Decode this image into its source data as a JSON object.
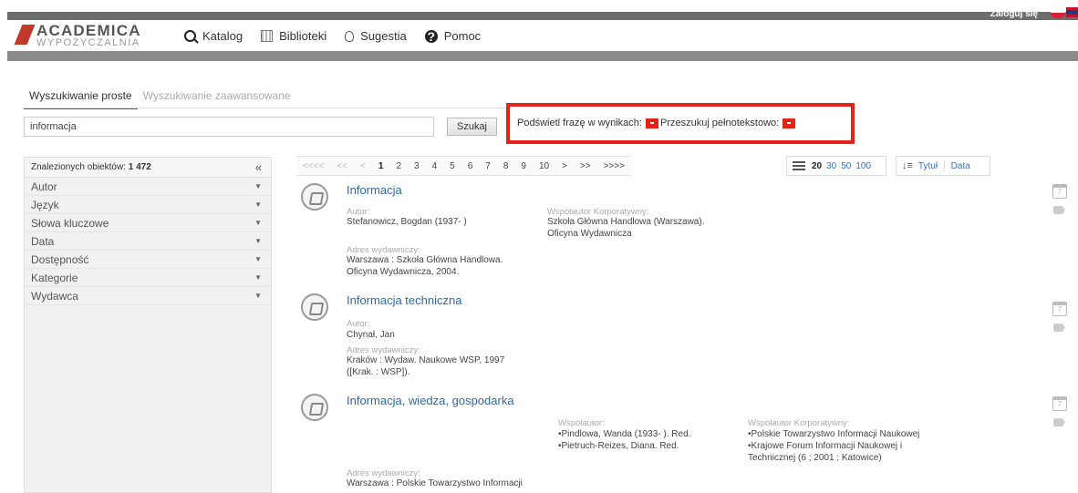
{
  "topbar": {
    "login": "Zaloguj się"
  },
  "logo": {
    "line1": "ACADEMICA",
    "line2": "WYPOŻYCZALNIA"
  },
  "nav": [
    {
      "label": "Katalog",
      "icon": "search-icon"
    },
    {
      "label": "Biblioteki",
      "icon": "library-icon"
    },
    {
      "label": "Sugestia",
      "icon": "lightbulb-icon"
    },
    {
      "label": "Pomoc",
      "icon": "help-icon"
    }
  ],
  "tabs": {
    "simple": "Wyszukiwanie proste",
    "advanced": "Wyszukiwanie zaawansowane"
  },
  "search": {
    "value": "informacja",
    "button": "Szukaj"
  },
  "options": {
    "highlight": "Podświetl frazę w wynikach:",
    "fulltext": "Przeszukuj pełnotekstowo:"
  },
  "sidebar": {
    "found_label": "Znalezionych obiektów:",
    "found_count": "1 472",
    "collapse": "«",
    "facets": [
      "Autor",
      "Język",
      "Słowa kluczowe",
      "Data",
      "Dostępność",
      "Kategorie",
      "Wydawca"
    ]
  },
  "pager": {
    "first": "<<<<",
    "prev_many": "<<",
    "prev": "<",
    "pages": [
      "1",
      "2",
      "3",
      "4",
      "5",
      "6",
      "7",
      "8",
      "9",
      "10"
    ],
    "next": ">",
    "next_many": ">>",
    "last": ">>>>"
  },
  "per_page": {
    "current": "20",
    "options": [
      "30",
      "50",
      "100"
    ]
  },
  "sort": {
    "title": "Tytuł",
    "date": "Data"
  },
  "results": [
    {
      "title": "Informacja",
      "author_label": "Autor:",
      "author": "Stefanowicz, Bogdan (1937- )",
      "corp_label": "Współautor Korporatywny:",
      "corp_lines": [
        "Szkoła Główna Handlowa (Warszawa).",
        "Oficyna Wydawnicza"
      ],
      "publisher_label": "Adres wydawniczy:",
      "publisher_lines": [
        "Warszawa : Szkoła Główna Handlowa.",
        "Oficyna Wydawnicza, 2004."
      ]
    },
    {
      "title": "Informacja techniczna",
      "author_label": "Autor:",
      "author": "Chynał, Jan",
      "publisher_label": "Adres wydawniczy:",
      "publisher_lines": [
        "Kraków : Wydaw. Naukowe WSP, 1997",
        "([Krak. : WSP])."
      ]
    },
    {
      "title": "Informacja, wiedza, gospodarka",
      "coauthor_label": "Współautor:",
      "coauthor_lines": [
        "•Pindlowa, Wanda (1933- ). Red.",
        "•Pietruch-Reizes, Diana. Red."
      ],
      "corp_label": "Współautor Korporatywny:",
      "corp_lines": [
        "•Polskie Towarzystwo Informacji Naukowej",
        "•Krajowe Forum Informacji Naukowej i",
        "Technicznej (6 ; 2001 ; Katowice)"
      ],
      "publisher_label": "Adres wydawniczy:",
      "publisher_lines": [
        "Warszawa : Polskie Towarzystwo Informacji"
      ]
    }
  ]
}
